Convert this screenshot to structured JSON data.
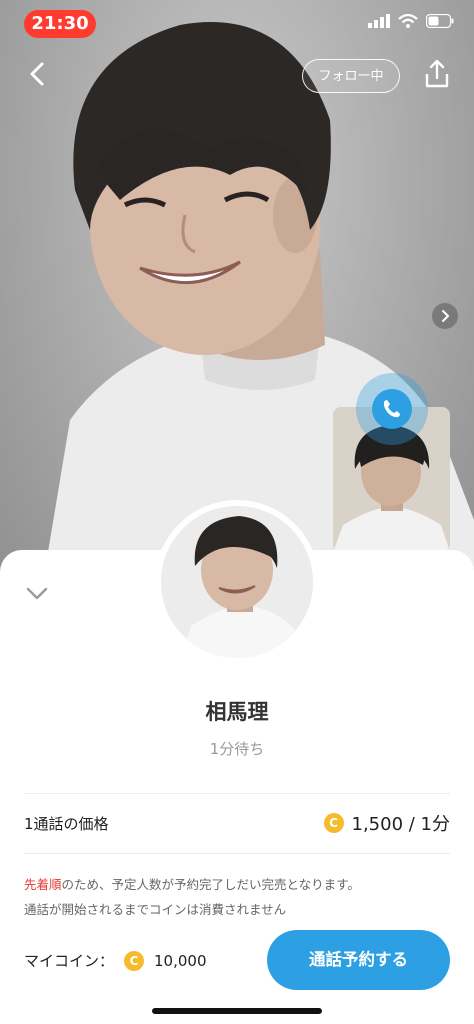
{
  "status_bar": {
    "time": "21:30"
  },
  "header": {
    "follow_label": "フォロー中"
  },
  "profile": {
    "name": "相馬理",
    "wait_status": "1分待ち"
  },
  "price": {
    "label": "1通話の価格",
    "value": "1,500 / 1分",
    "coin_symbol": "C"
  },
  "notice": {
    "highlight": "先着順",
    "line1_rest": "のため、予定人数が予約完了しだい完売となります。",
    "line2": "通話が開始されるまでコインは消費されません"
  },
  "wallet": {
    "label": "マイコイン：",
    "balance": "10,000"
  },
  "actions": {
    "reserve_label": "通話予約する"
  },
  "icons": {
    "back": "chevron-left-icon",
    "share": "share-icon",
    "next": "chevron-right-icon",
    "call": "phone-icon",
    "collapse": "chevron-down-icon",
    "coin": "coin-icon"
  },
  "colors": {
    "accent": "#2d9fe3",
    "time_pill": "#ff3b30",
    "highlight_red": "#e53935",
    "coin": "#f5bb2a"
  }
}
